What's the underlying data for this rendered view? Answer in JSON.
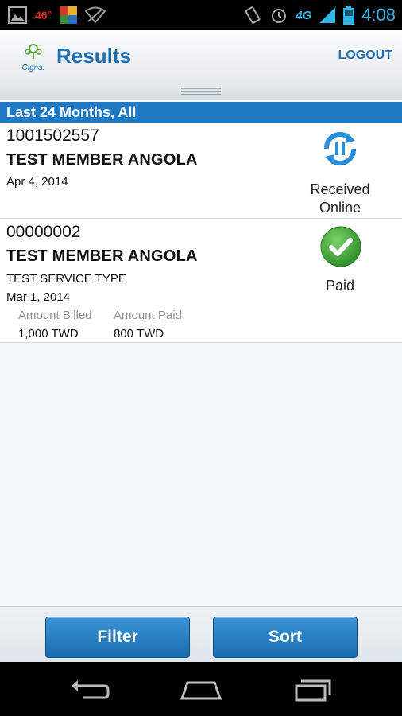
{
  "status_bar": {
    "temperature": "46°",
    "network": "4G",
    "time": "4:08"
  },
  "header": {
    "logo_text": "Cigna.",
    "title": "Results",
    "logout_label": "LOGOUT"
  },
  "filter_bar": {
    "label": "Last 24 Months, All"
  },
  "claims": [
    {
      "id": "1001502557",
      "member": "TEST MEMBER ANGOLA",
      "date": "Apr 4, 2014",
      "status_icon": "sync-icon",
      "status_line1": "Received",
      "status_line2": "Online"
    },
    {
      "id": "00000002",
      "member": "TEST MEMBER ANGOLA",
      "service_type": "TEST SERVICE TYPE",
      "date": "Mar 1, 2014",
      "amount_billed_label": "Amount Billed",
      "amount_paid_label": "Amount Paid",
      "amount_billed": "1,000 TWD",
      "amount_paid": "800 TWD",
      "status_icon": "checkmark-icon",
      "status_line1": "Paid"
    }
  ],
  "toolbar": {
    "filter_label": "Filter",
    "sort_label": "Sort"
  },
  "colors": {
    "brand_blue": "#1d6fb0",
    "section_blue": "#1f78c3",
    "paid_green": "#3aa33a"
  }
}
